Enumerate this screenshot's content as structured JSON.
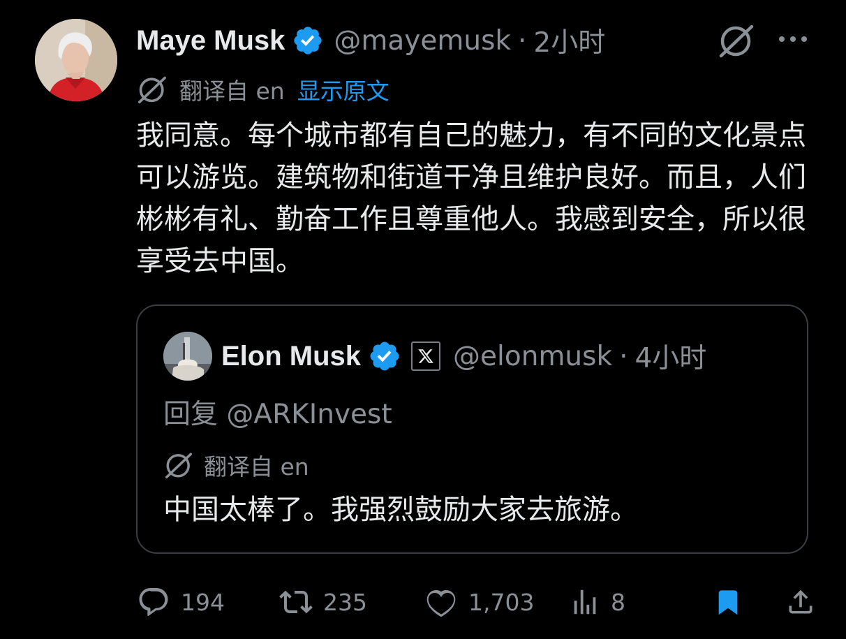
{
  "tweet": {
    "author_name": "Maye Musk",
    "handle": "@mayemusk",
    "separator": "·",
    "time": "2小时",
    "translated_from": "翻译自 en",
    "show_original": "显示原文",
    "text": "我同意。每个城市都有自己的魅力，有不同的文化景点可以游览。建筑物和街道干净且维护良好。而且，人们彬彬有礼、勤奋工作且尊重他人。我感到安全，所以很享受去中国。"
  },
  "quote": {
    "author_name": "Elon Musk",
    "handle": "@elonmusk",
    "separator": "·",
    "time": "4小时",
    "reply_to": "回复 @ARKInvest",
    "translated_from": "翻译自 en",
    "text": "中国太棒了。我强烈鼓励大家去旅游。"
  },
  "actions": {
    "replies": "194",
    "retweets": "235",
    "likes": "1,703",
    "views": "8"
  },
  "colors": {
    "background": "#000000",
    "text": "#e7e9ea",
    "secondary": "#8b9096",
    "link": "#1d9bf0",
    "verified": "#1d9bf0",
    "border": "#3a3e42"
  },
  "icons": {
    "verified": "verified-badge-icon",
    "grok": "grok-icon",
    "more": "more-icon",
    "x_logo": "x-logo-icon",
    "reply": "reply-icon",
    "retweet": "retweet-icon",
    "like": "like-icon",
    "views": "views-icon",
    "bookmark": "bookmark-icon",
    "share": "share-icon"
  }
}
